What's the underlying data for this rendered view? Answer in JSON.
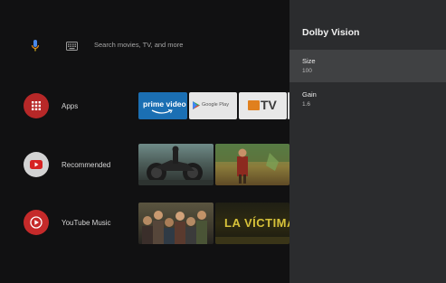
{
  "search": {
    "placeholder": "Search movies, TV, and more"
  },
  "rows": [
    {
      "label": "Apps"
    },
    {
      "label": "Recommended"
    },
    {
      "label": "YouTube Music"
    }
  ],
  "apps": [
    {
      "name": "prime video"
    },
    {
      "name": "Google Play"
    },
    {
      "name": "TV"
    }
  ],
  "thumbnail_texts": {
    "music_2": "LA VÍCTIMA"
  },
  "panel": {
    "title": "Dolby Vision",
    "options": [
      {
        "name": "Size",
        "value": "100"
      },
      {
        "name": "Gain",
        "value": "1.6"
      }
    ]
  },
  "colors": {
    "row_icon_red": "#c52a2a",
    "panel_bg": "#2b2c2e",
    "selected_bg": "#404143",
    "mic_blue": "#4a88e8"
  }
}
